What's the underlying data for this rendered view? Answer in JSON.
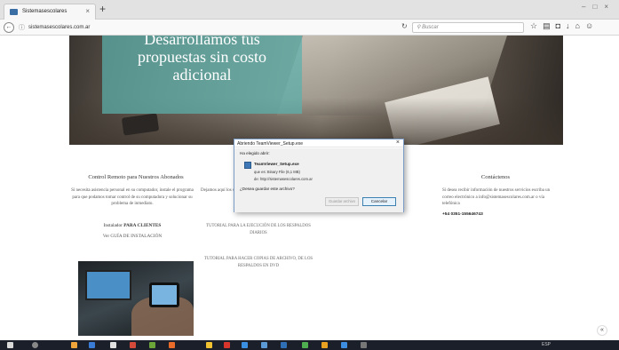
{
  "browser": {
    "tab_title": "Sistemasescolares",
    "tab_close": "×",
    "new_tab": "+",
    "url": "sistemasescolares.com.ar",
    "search_placeholder": "Buscar",
    "icons": [
      "search-icon",
      "star-icon",
      "reading-list-icon",
      "pocket-icon",
      "download-icon",
      "home-icon",
      "smiley-icon"
    ]
  },
  "hero": {
    "line1": "Desarrollamos tus",
    "line2": "propuestas sin costo",
    "line3": "adicional",
    "overlay_color": "#5cb0ac"
  },
  "col1": {
    "title": "Control Remoto para Nuestros Abonados",
    "text": "Si necesita asistencia personal en su computador, instale el programa para que podamos tomar control de su computadora y solucionar su problema de inmediato.",
    "installer_label": "Instalador",
    "installer_strong": "PARA CLIENTES",
    "guide": "Ver GUÍA DE INSTALACIÓN"
  },
  "col2": {
    "text": "Dejamos aquí los sesp",
    "tutorial1": "TUTORIAL PARA LA EJECUCIÓN DE LOS RESPALDOS DIARIOS",
    "tutorial2": "TUTORIAL PARA HACER COPIAS DE ARCHIVO, DE LOS RESPALDOS EN DVD"
  },
  "col3": {
    "title": "Contáctenos",
    "text": "Si desea recibir información de nuestros servicios escriba un correo electrónico a info@sistemasescolares.com.ar o vía telefónica",
    "phone": "+54 0351-155646743"
  },
  "dialog": {
    "title": "Abriendo TeamViewer_Setup.exe",
    "close": "×",
    "prompt": "Ha elegido abrir:",
    "file_name": "TeamViewer_Setup.exe",
    "file_type": "que es: Binary File (6,1 MB)",
    "file_from": "de: http://sistemasescolares.com.ar",
    "question": "¿Desea guardar este archivo?",
    "save_label": "Guardar archivo",
    "cancel_label": "Cancelar"
  },
  "scroll_top": "«",
  "taskbar": {
    "tray": "ESP"
  }
}
